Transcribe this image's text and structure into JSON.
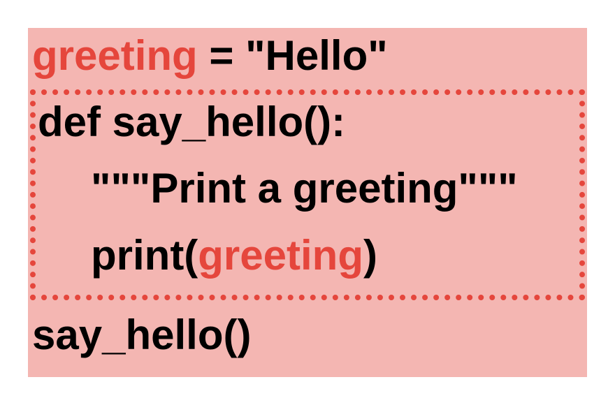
{
  "colors": {
    "background": "#f4b6b2",
    "highlight": "#e5463c",
    "text": "#000000",
    "scope_border": "#e5463c"
  },
  "code": {
    "line1": {
      "var": "greeting",
      "rest": " = \"Hello\""
    },
    "line2": {
      "text": "def say_hello():"
    },
    "line3": {
      "text": "\"\"\"Print a greeting\"\"\""
    },
    "line4": {
      "pre": "print(",
      "var": "greeting",
      "post": ")"
    },
    "line5": {
      "text": "say_hello()"
    }
  }
}
